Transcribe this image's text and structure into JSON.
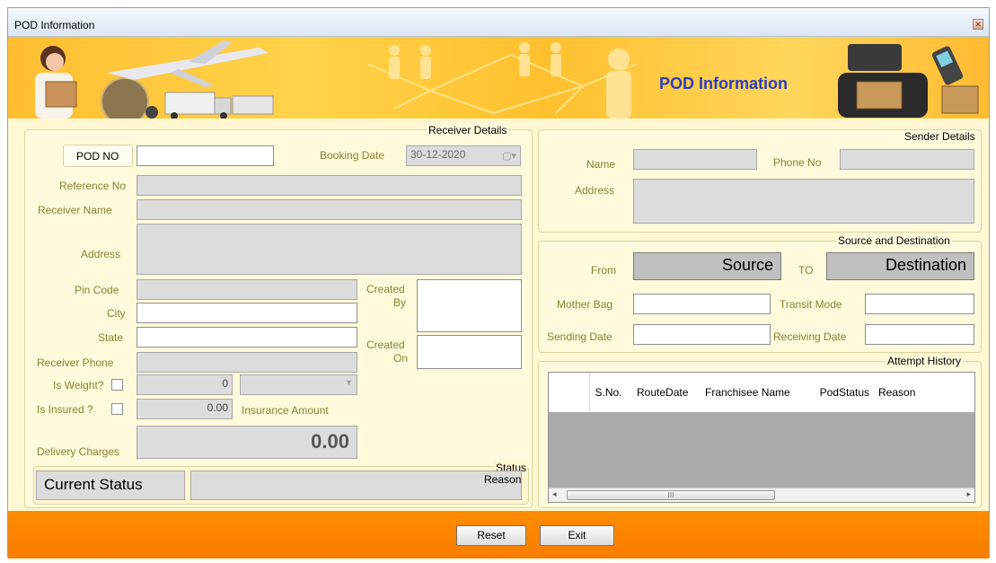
{
  "window": {
    "title": "POD Information"
  },
  "banner": {
    "title": "POD Information"
  },
  "receiver": {
    "group_label": "Receiver Details",
    "pod_no_label": "POD NO",
    "pod_no_value": "",
    "booking_date_label": "Booking Date",
    "booking_date_value": "30-12-2020",
    "reference_no_label": "Reference No",
    "receiver_name_label": "Receiver Name",
    "address_label": "Address",
    "pin_code_label": "Pin Code",
    "city_label": "City",
    "state_label": "State",
    "receiver_phone_label": "Receiver Phone",
    "created_by_label_1": "Created",
    "created_by_label_2": "By",
    "created_on_label_1": "Created",
    "created_on_label_2": "On",
    "is_weight_label": "Is Weight?",
    "weight_value": "0",
    "is_insured_label": "Is Insured ?",
    "insured_value": "0.00",
    "insurance_amount_label": "Insurance Amount",
    "delivery_charges_label": "Delivery Charges",
    "delivery_charges_value": "0.00"
  },
  "status": {
    "group_label": "Status",
    "current_status_label": "Current Status",
    "reason_label": "Reason"
  },
  "sender": {
    "group_label": "Sender Details",
    "name_label": "Name",
    "phone_label": "Phone No",
    "address_label": "Address"
  },
  "source_dest": {
    "group_label": "Source and Destination",
    "from_label": "From",
    "source_value": "Source",
    "to_label": "TO",
    "destination_value": "Destination",
    "mother_bag_label": "Mother Bag",
    "transit_mode_label": "Transit Mode",
    "sending_date_label": "Sending Date",
    "receiving_date_label": "Receiving Date"
  },
  "attempt_history": {
    "group_label": "Attempt History",
    "columns": [
      "S.No.",
      "RouteDate",
      "Franchisee Name",
      "PodStatus",
      "Reason"
    ],
    "scroll_thumb_glyph": "III"
  },
  "buttons": {
    "reset": "Reset",
    "exit": "Exit"
  },
  "colors": {
    "footer": "#ff8c00",
    "banner_title": "#2b3dbf",
    "label": "#8a8230"
  }
}
